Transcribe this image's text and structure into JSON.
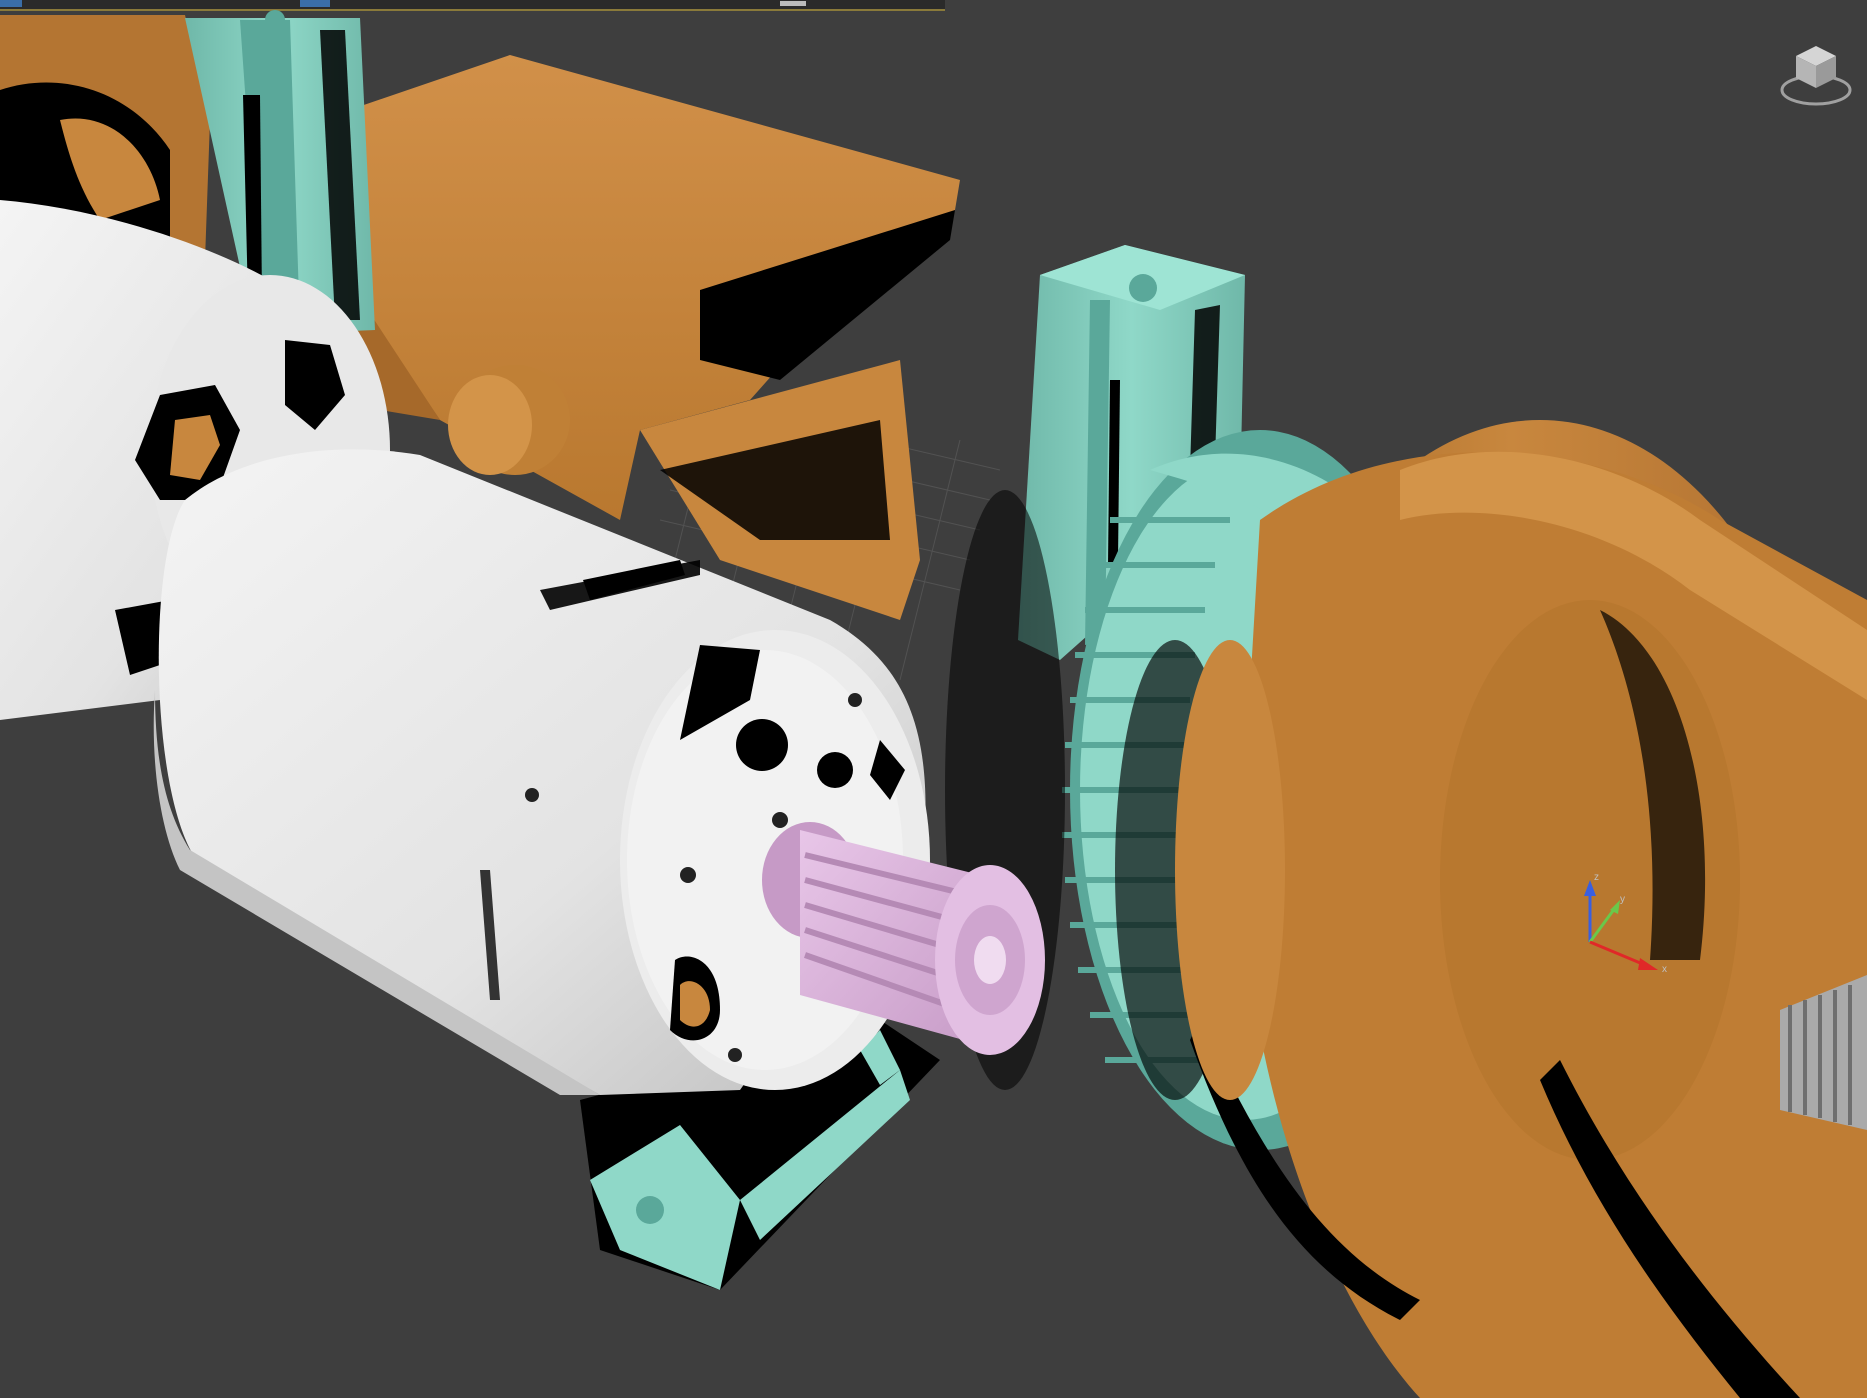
{
  "viewport": {
    "background": "#3e3e3e",
    "grid_color": "#5a5a5a"
  },
  "colors": {
    "orange": "#c8873e",
    "orange_light": "#d89a52",
    "orange_dark": "#9a6322",
    "teal": "#8fd8c8",
    "teal_dark": "#5aa89a",
    "white_metal": "#e9e9e9",
    "white_shade": "#b8b8b8",
    "pink": "#d8b0d8",
    "shadow": "#000000"
  },
  "icons": {
    "viewcube": "viewcube-icon",
    "axis_gizmo": "axis-gizmo-icon"
  },
  "objects": [
    "aluminium-extrusion-back",
    "aluminium-extrusion-front",
    "aluminium-extrusion-bottom",
    "motor-rear",
    "motor-front",
    "small-pulley",
    "large-pulley",
    "spool",
    "bracket",
    "threaded-rod"
  ]
}
